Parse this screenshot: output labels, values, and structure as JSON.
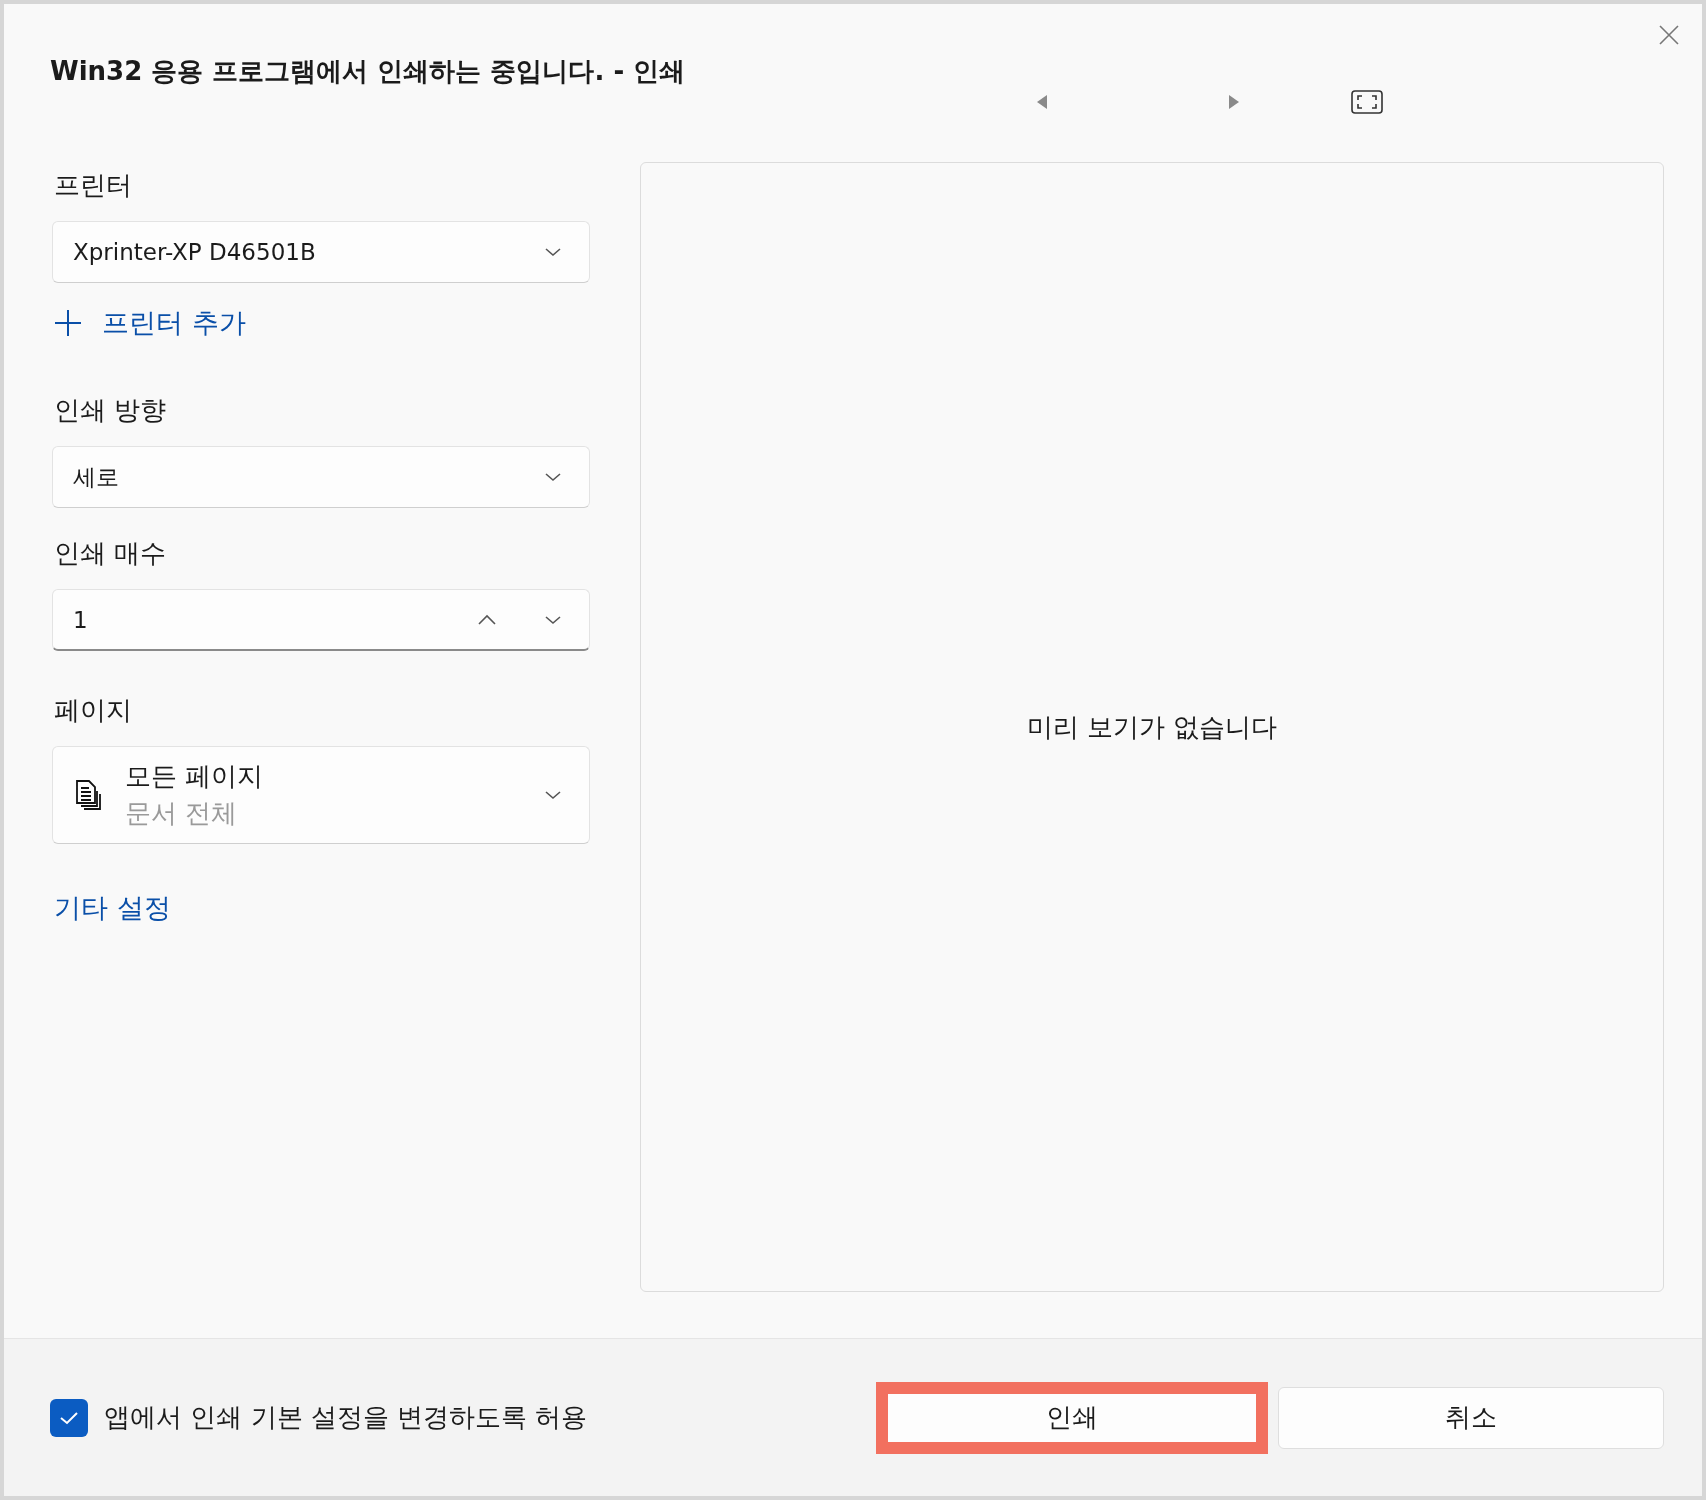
{
  "dialog": {
    "title": "Win32 응용 프로그램에서 인쇄하는 중입니다. - 인쇄"
  },
  "printer": {
    "label": "프린터",
    "value": "Xprinter-XP D46501B"
  },
  "add_printer_link": "프린터 추가",
  "orientation": {
    "label": "인쇄 방향",
    "value": "세로"
  },
  "copies": {
    "label": "인쇄 매수",
    "value": "1"
  },
  "pages": {
    "label": "페이지",
    "value": "모든 페이지",
    "description": "문서 전체"
  },
  "more_settings_link": "기타 설정",
  "preview": {
    "message": "미리 보기가 없습니다"
  },
  "footer": {
    "checkbox": {
      "label": "앱에서 인쇄 기본 설정을 변경하도록 허용",
      "checked": true
    },
    "buttons": [
      {
        "label": "인쇄",
        "highlighted": true
      },
      {
        "label": "취소",
        "highlighted": false
      }
    ]
  }
}
